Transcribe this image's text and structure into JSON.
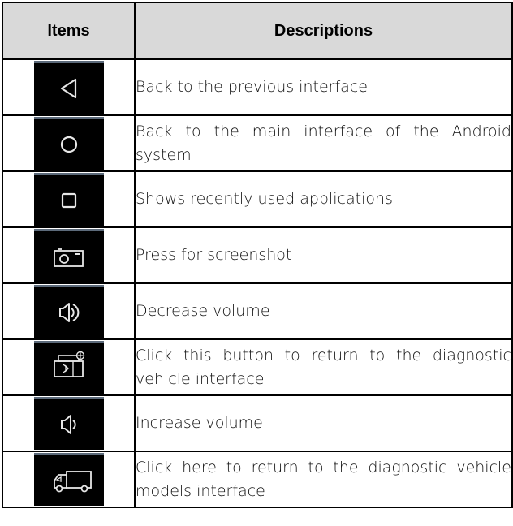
{
  "table": {
    "headers": {
      "items": "Items",
      "descriptions": "Descriptions"
    },
    "rows": [
      {
        "icon": "back-triangle-icon",
        "description": "Back to the previous interface"
      },
      {
        "icon": "home-circle-icon",
        "description": "Back to the main interface of the Android system"
      },
      {
        "icon": "recent-apps-square-icon",
        "description": "Shows recently used applications"
      },
      {
        "icon": "camera-screenshot-icon",
        "description": "Press for screenshot"
      },
      {
        "icon": "volume-decrease-icon",
        "description": "Decrease volume"
      },
      {
        "icon": "vci-bluetooth-icon",
        "description": "Click this button to return to the diagnostic vehicle interface"
      },
      {
        "icon": "volume-increase-icon",
        "description": "Increase volume"
      },
      {
        "icon": "truck-icon",
        "description": "Click here to return to the diagnostic vehicle models interface"
      }
    ]
  },
  "colors": {
    "header_bg": "#d9d9d9",
    "icon_bg": "#000000",
    "icon_stroke": "#e6e6e6",
    "border": "#000000"
  }
}
